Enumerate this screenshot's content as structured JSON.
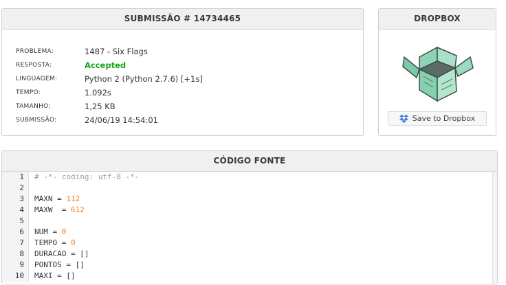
{
  "submission": {
    "title": "SUBMISSÃO # 14734465",
    "rows": [
      {
        "label": "PROBLEMA:",
        "value": "1487 - Six Flags"
      },
      {
        "label": "RESPOSTA:",
        "value": "Accepted"
      },
      {
        "label": "LINGUAGEM:",
        "value": "Python 2 (Python 2.7.6) [+1s]"
      },
      {
        "label": "TEMPO:",
        "value": "1.092s"
      },
      {
        "label": "TAMANHO:",
        "value": "1,25 KB"
      },
      {
        "label": "SUBMISSÃO:",
        "value": "24/06/19 14:54:01"
      }
    ],
    "accepted_color": "#19a319"
  },
  "dropbox": {
    "title": "DROPBOX",
    "button_label": "Save to Dropbox",
    "icon": "dropbox-icon",
    "art": "open-box-illustration"
  },
  "source": {
    "title": "CÓDIGO FONTE",
    "lines": [
      {
        "n": "1",
        "code": "# -*- coding: utf-8 -*-"
      },
      {
        "n": "2",
        "code": ""
      },
      {
        "n": "3",
        "code": "MAXN = 112"
      },
      {
        "n": "4",
        "code": "MAXW  = 612"
      },
      {
        "n": "5",
        "code": ""
      },
      {
        "n": "6",
        "code": "NUM = 0"
      },
      {
        "n": "7",
        "code": "TEMPO = 0"
      },
      {
        "n": "8",
        "code": "DURACAO = []"
      },
      {
        "n": "9",
        "code": "PONTOS = []"
      },
      {
        "n": "10",
        "code": "MAXI = []"
      }
    ],
    "comment_color": "#9a9a9a",
    "number_color": "#f08020"
  }
}
